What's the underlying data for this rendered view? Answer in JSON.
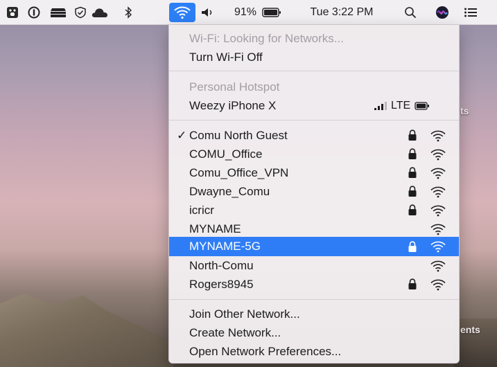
{
  "menubar": {
    "icons": [
      "bear-icon",
      "onepassword-icon",
      "synology-icon",
      "shield-icon",
      "cloud-icon",
      "bluetooth-icon",
      "wifi-icon",
      "volume-icon",
      "battery-icon",
      "spotlight-search-icon",
      "siri-icon",
      "notification-center-icon"
    ],
    "battery_percent": "91%",
    "clock": "Tue 3:22 PM"
  },
  "desktop": {
    "label_1": "ts",
    "label_2": "ents"
  },
  "wifi_menu": {
    "status": "Wi-Fi: Looking for Networks...",
    "toggle_label": "Turn Wi-Fi Off",
    "hotspot_header": "Personal Hotspot",
    "hotspot_device": "Weezy iPhone X",
    "hotspot_network_type": "LTE",
    "networks": [
      {
        "name": "Comu North Guest",
        "secured": true,
        "connected": true,
        "highlighted": false
      },
      {
        "name": "COMU_Office",
        "secured": true,
        "connected": false,
        "highlighted": false
      },
      {
        "name": "Comu_Office_VPN",
        "secured": true,
        "connected": false,
        "highlighted": false
      },
      {
        "name": "Dwayne_Comu",
        "secured": true,
        "connected": false,
        "highlighted": false
      },
      {
        "name": "icricr",
        "secured": true,
        "connected": false,
        "highlighted": false
      },
      {
        "name": "MYNAME",
        "secured": false,
        "connected": false,
        "highlighted": false
      },
      {
        "name": "MYNAME-5G",
        "secured": true,
        "connected": false,
        "highlighted": true
      },
      {
        "name": "North-Comu",
        "secured": false,
        "connected": false,
        "highlighted": false
      },
      {
        "name": "Rogers8945",
        "secured": true,
        "connected": false,
        "highlighted": false
      }
    ],
    "checkmark": "✓",
    "actions": [
      "Join Other Network...",
      "Create Network...",
      "Open Network Preferences..."
    ]
  },
  "colors": {
    "highlight": "#2f7df6",
    "menubar_bg": "#f2eff2",
    "menu_bg": "#f2edf0"
  }
}
